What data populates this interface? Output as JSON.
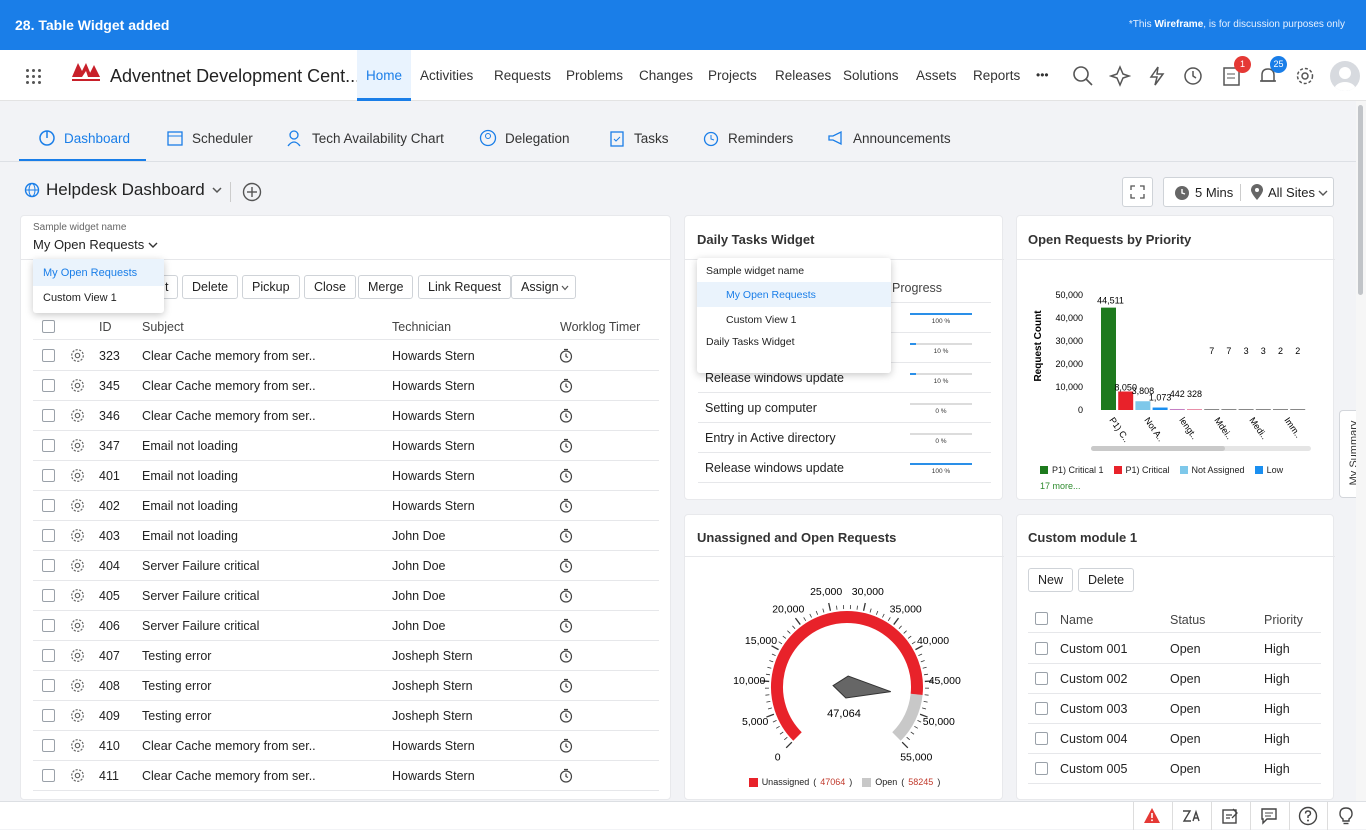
{
  "banner": {
    "title": "28. Table Widget added",
    "note_prefix": "*This ",
    "note_bold": "Wireframe",
    "note_suffix": ", is for discussion purposes only"
  },
  "app": {
    "brand": "Adventnet Development Cent...",
    "nav": [
      "Home",
      "Activities",
      "Requests",
      "Problems",
      "Changes",
      "Projects",
      "Releases",
      "Solutions",
      "Assets",
      "Reports"
    ],
    "more": "•••",
    "badges": {
      "tasks": "1",
      "notifications": "25"
    },
    "colors": {
      "accent": "#1a7ee8",
      "badge_red": "#e53935",
      "badge_blue": "#1a7ee8"
    }
  },
  "tabs": [
    "Dashboard",
    "Scheduler",
    "Tech Availability Chart",
    "Delegation",
    "Tasks",
    "Reminders",
    "Announcements"
  ],
  "dashboard": {
    "title": "Helpdesk Dashboard",
    "refresh": "5 Mins",
    "sites": "All Sites"
  },
  "requests": {
    "widget_label": "Sample widget name",
    "selected": "My Open Requests",
    "dropdown": [
      "My Open Requests",
      "Custom View 1"
    ],
    "buttons": [
      "t",
      "Delete",
      "Pickup",
      "Close",
      "Merge",
      "Link Request",
      "Assign"
    ],
    "headers": [
      "ID",
      "Subject",
      "Technician",
      "Worklog Timer"
    ],
    "rows": [
      [
        "323",
        "Clear Cache memory from ser..",
        "Howards Stern"
      ],
      [
        "345",
        "Clear Cache memory from ser..",
        "Howards Stern"
      ],
      [
        "346",
        "Clear Cache memory from ser..",
        "Howards Stern"
      ],
      [
        "347",
        "Email not loading",
        "Howards Stern"
      ],
      [
        "401",
        "Email not loading",
        "Howards Stern"
      ],
      [
        "402",
        "Email not loading",
        "Howards Stern"
      ],
      [
        "403",
        "Email not loading",
        "John Doe"
      ],
      [
        "404",
        "Server Failure critical",
        "John Doe"
      ],
      [
        "405",
        "Server Failure critical",
        "John Doe"
      ],
      [
        "406",
        "Server Failure critical",
        "John Doe"
      ],
      [
        "407",
        "Testing error",
        "Josheph Stern"
      ],
      [
        "408",
        "Testing error",
        "Josheph Stern"
      ],
      [
        "409",
        "Testing error",
        "Josheph Stern"
      ],
      [
        "410",
        "Clear Cache memory from ser..",
        "Howards Stern"
      ],
      [
        "411",
        "Clear Cache memory from ser..",
        "Howards Stern"
      ]
    ]
  },
  "tasks": {
    "title": "Daily Tasks Widget",
    "progress_header": "Progress",
    "dropdown": {
      "label": "Sample widget name",
      "items": [
        "My Open Requests",
        "Custom View 1"
      ],
      "footer": "Daily Tasks Widget"
    },
    "rows": [
      {
        "name": "",
        "progress": 100,
        "label": "100 %"
      },
      {
        "name": "",
        "progress": 10,
        "label": "10 %"
      },
      {
        "name": "Release windows update",
        "progress": 10,
        "label": "10 %"
      },
      {
        "name": "Setting up computer",
        "progress": 0,
        "label": "0 %"
      },
      {
        "name": "Entry in Active directory",
        "progress": 0,
        "label": "0 %"
      },
      {
        "name": "Release windows update",
        "progress": 100,
        "label": "100 %"
      }
    ]
  },
  "priority": {
    "title": "Open Requests by Priority",
    "more": "17 more...",
    "legend": [
      {
        "name": "P1) Critical 1",
        "color": "#1e7a1e"
      },
      {
        "name": "P1) Critical",
        "color": "#e8222a"
      },
      {
        "name": "Not Assigned",
        "color": "#7ec8ea"
      },
      {
        "name": "Low",
        "color": "#1a8ff0"
      }
    ]
  },
  "chart_data": [
    {
      "type": "bar",
      "title": "Open Requests by Priority",
      "ylabel": "Request Count",
      "ylim": [
        0,
        50000
      ],
      "yticks": [
        "50,000",
        "40,000",
        "30,000",
        "20,000",
        "10,000",
        "0"
      ],
      "categories": [
        "P1) C..",
        "Not A..",
        "lengt..",
        "Mdei..",
        "Medi..",
        "Imm.."
      ],
      "values": [
        44511,
        8050,
        3808,
        1073,
        442,
        328,
        7,
        7,
        3,
        3,
        2,
        2
      ],
      "value_labels": [
        "44,511",
        "8,050",
        "3,808",
        "1,073",
        "442",
        "328",
        "7",
        "7",
        "3",
        "3",
        "2",
        "2"
      ],
      "colors": [
        "#1e7a1e",
        "#e8222a",
        "#7ec8ea",
        "#1a8ff0",
        "#c47fc4",
        "#e88fa8",
        "#888888",
        "#888888",
        "#888888",
        "#888888",
        "#888888",
        "#888888"
      ]
    },
    {
      "type": "gauge",
      "title": "Unassigned and Open Requests",
      "value": 47064,
      "value_label": "47,064",
      "min": 0,
      "max": 55000,
      "ticks": [
        "0",
        "5,000",
        "10,000",
        "15,000",
        "20,000",
        "25,000",
        "30,000",
        "35,000",
        "40,000",
        "45,000",
        "50,000",
        "55,000"
      ],
      "series": [
        {
          "name": "Unassigned",
          "value": 47064,
          "label": "47064",
          "color": "#e8222a"
        },
        {
          "name": "Open",
          "value": 58245,
          "label": "58245",
          "color": "#c8c8c8"
        }
      ]
    }
  ],
  "custom": {
    "title": "Custom module 1",
    "buttons": [
      "New",
      "Delete"
    ],
    "headers": [
      "Name",
      "Status",
      "Priority"
    ],
    "rows": [
      [
        "Custom 001",
        "Open",
        "High"
      ],
      [
        "Custom 002",
        "Open",
        "High"
      ],
      [
        "Custom 003",
        "Open",
        "High"
      ],
      [
        "Custom 004",
        "Open",
        "High"
      ],
      [
        "Custom 005",
        "Open",
        "High"
      ]
    ]
  },
  "side": "My Summary"
}
